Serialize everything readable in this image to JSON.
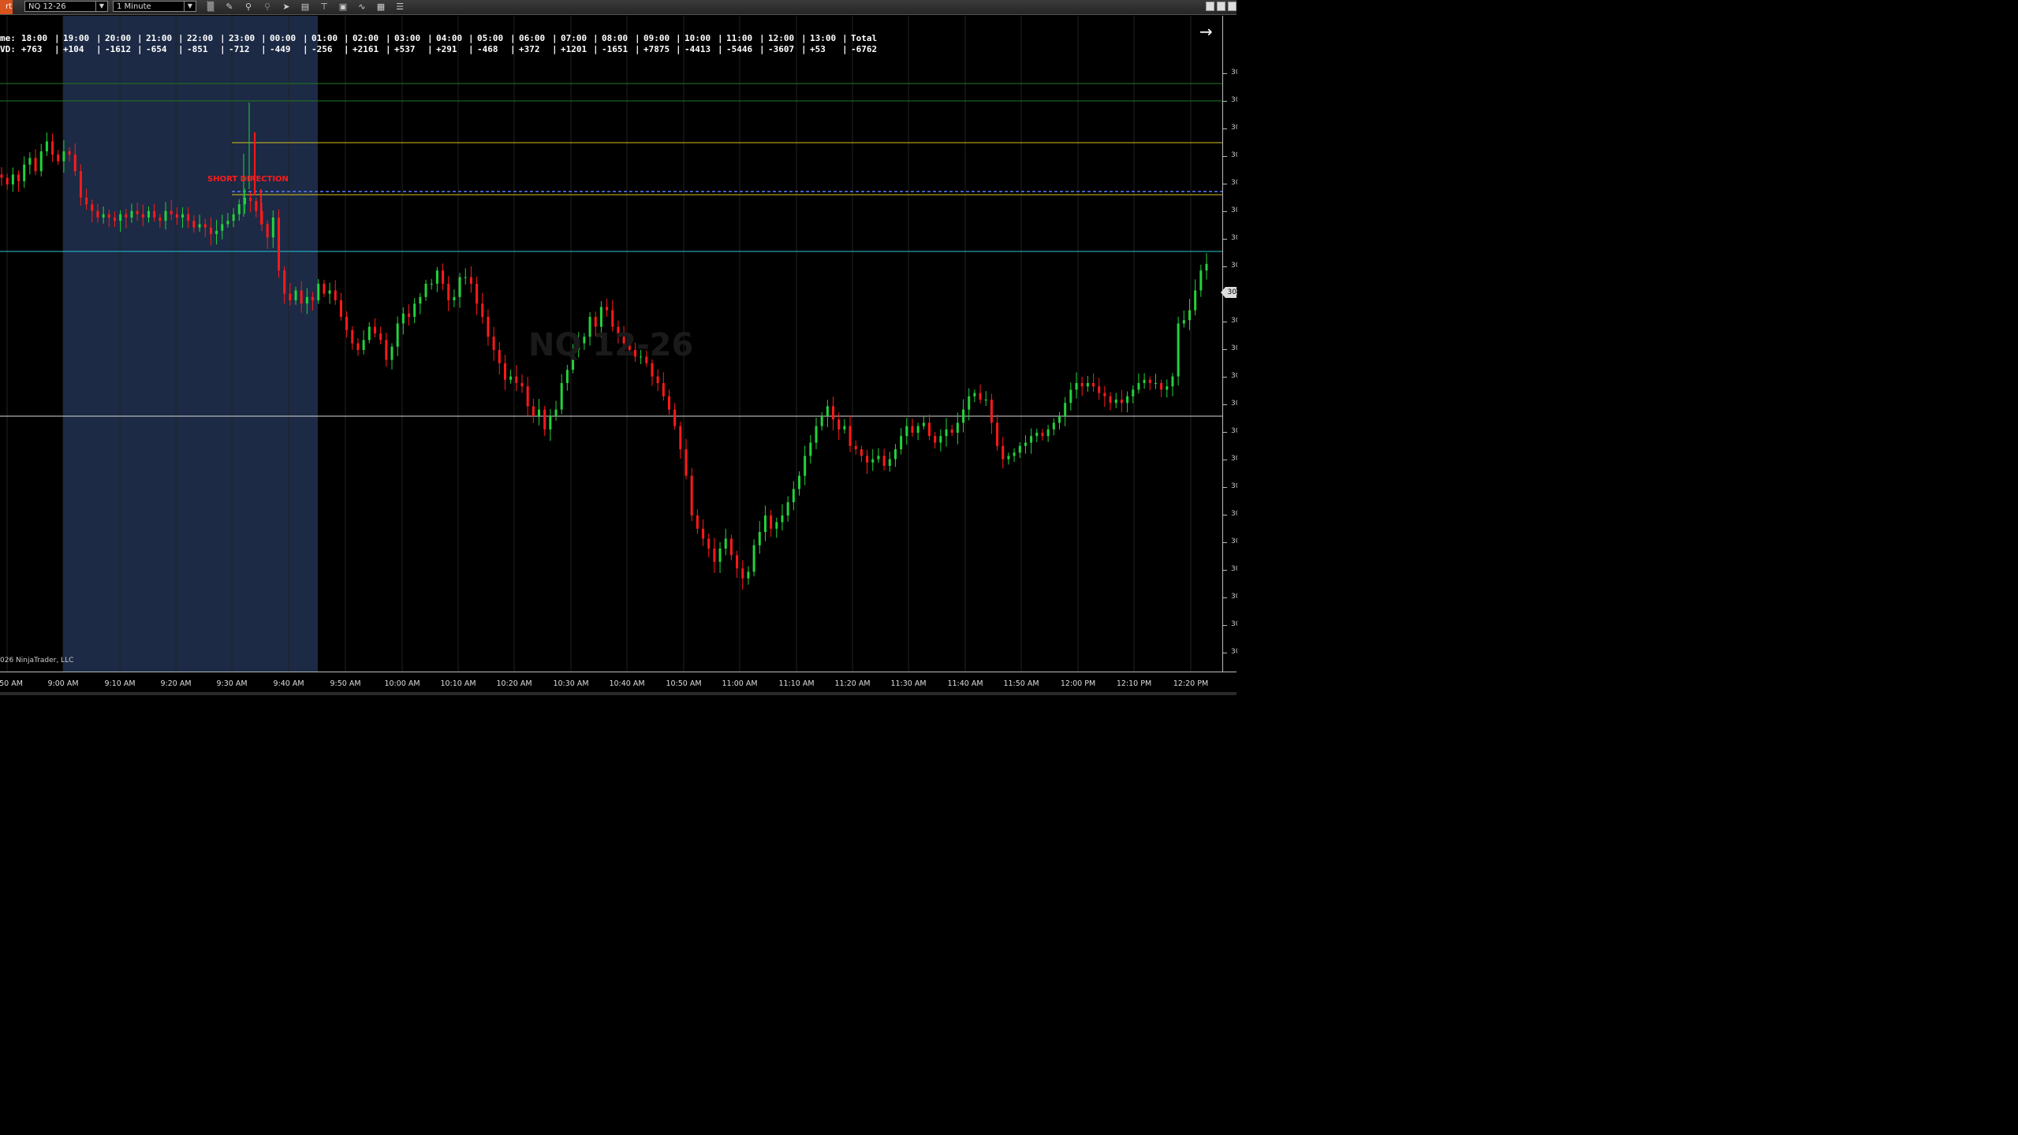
{
  "app_tab": "rt",
  "instrument": "NQ 12-26",
  "interval": "1 Minute",
  "toolbar_icons": [
    "bar-chart-icon",
    "pencil-icon",
    "zoom-in-icon",
    "zoom-out-icon",
    "pointer-icon",
    "document-icon",
    "indicators-icon",
    "strategies-icon",
    "drawing-tools-icon",
    "properties-icon",
    "list-icon"
  ],
  "colors": {
    "up": "#22d33b",
    "down": "#ff1a1a",
    "session_shade": "#1c2a45",
    "green_line": "#1f7a1f",
    "yellow_line": "#d8c21a",
    "blue_dash": "#5b7dff",
    "cyan_line": "#27c7d6",
    "white_line": "#d9d9d9"
  },
  "stats": {
    "time_label": "me:",
    "vd_label": "VD:",
    "hours": [
      "18:00",
      "19:00",
      "20:00",
      "21:00",
      "22:00",
      "23:00",
      "00:00",
      "01:00",
      "02:00",
      "03:00",
      "04:00",
      "05:00",
      "06:00",
      "07:00",
      "08:00",
      "09:00",
      "10:00",
      "11:00",
      "12:00",
      "13:00",
      "Total"
    ],
    "values": [
      "+763",
      "+104",
      "-1612",
      "-654",
      "-851",
      "-712",
      "-449",
      "-256",
      "+2161",
      "+537",
      "+291",
      "-468",
      "+372",
      "+1201",
      "-1651",
      "+7875",
      "-4413",
      "-5446",
      "-3607",
      "+53",
      "-6762"
    ]
  },
  "signal_label": "SHORT DIRECTION",
  "watermark": "NQ 12-26",
  "copyright": "026 NinjaTrader, LLC",
  "price_axis_label": "30",
  "current_price_label": "30",
  "x_axis_labels": [
    "50 AM",
    "9:00 AM",
    "9:10 AM",
    "9:20 AM",
    "9:30 AM",
    "9:40 AM",
    "9:50 AM",
    "10:00 AM",
    "10:10 AM",
    "10:20 AM",
    "10:30 AM",
    "10:40 AM",
    "10:50 AM",
    "11:00 AM",
    "11:10 AM",
    "11:20 AM",
    "11:30 AM",
    "11:40 AM",
    "11:50 AM",
    "12:00 PM",
    "12:10 PM",
    "12:20 PM"
  ],
  "chart_data": {
    "type": "candlestick",
    "interval": "1 Minute",
    "x_labels": [
      "50 AM",
      "9:00 AM",
      "9:10 AM",
      "9:20 AM",
      "9:30 AM",
      "9:40 AM",
      "9:50 AM",
      "10:00 AM",
      "10:10 AM",
      "10:20 AM",
      "10:30 AM",
      "10:40 AM",
      "10:50 AM",
      "11:00 AM",
      "11:10 AM",
      "11:20 AM",
      "11:30 AM",
      "11:40 AM",
      "11:50 AM",
      "12:00 PM",
      "12:10 PM",
      "12:20 PM"
    ],
    "closes": [
      0.72,
      0.7,
      0.73,
      0.71,
      0.76,
      0.78,
      0.74,
      0.8,
      0.83,
      0.79,
      0.77,
      0.8,
      0.79,
      0.74,
      0.66,
      0.64,
      0.62,
      0.6,
      0.61,
      0.6,
      0.59,
      0.61,
      0.6,
      0.62,
      0.61,
      0.6,
      0.62,
      0.6,
      0.59,
      0.62,
      0.61,
      0.6,
      0.61,
      0.59,
      0.57,
      0.58,
      0.57,
      0.55,
      0.56,
      0.58,
      0.59,
      0.61,
      0.64,
      0.66,
      0.65,
      0.62,
      0.58,
      0.54,
      0.6,
      0.44,
      0.37,
      0.35,
      0.38,
      0.34,
      0.36,
      0.35,
      0.4,
      0.37,
      0.38,
      0.35,
      0.3,
      0.26,
      0.22,
      0.2,
      0.23,
      0.27,
      0.25,
      0.23,
      0.17,
      0.21,
      0.28,
      0.31,
      0.3,
      0.34,
      0.36,
      0.4,
      0.4,
      0.44,
      0.4,
      0.35,
      0.36,
      0.42,
      0.42,
      0.4,
      0.34,
      0.3,
      0.24,
      0.2,
      0.16,
      0.11,
      0.12,
      0.1,
      0.09,
      0.03,
      0.0,
      0.02,
      -0.04,
      0.0,
      0.02,
      0.1,
      0.14,
      0.2,
      0.22,
      0.24,
      0.3,
      0.27,
      0.33,
      0.32,
      0.27,
      0.24,
      0.22,
      0.2,
      0.18,
      0.18,
      0.16,
      0.12,
      0.1,
      0.06,
      0.02,
      -0.03,
      -0.1,
      -0.18,
      -0.3,
      -0.34,
      -0.37,
      -0.4,
      -0.44,
      -0.4,
      -0.37,
      -0.42,
      -0.46,
      -0.49,
      -0.47,
      -0.39,
      -0.35,
      -0.3,
      -0.34,
      -0.32,
      -0.3,
      -0.26,
      -0.22,
      -0.18,
      -0.12,
      -0.08,
      -0.03,
      0.0,
      0.03,
      -0.01,
      -0.04,
      -0.03,
      -0.09,
      -0.1,
      -0.12,
      -0.14,
      -0.13,
      -0.12,
      -0.15,
      -0.13,
      -0.1,
      -0.06,
      -0.03,
      -0.05,
      -0.03,
      -0.02,
      -0.06,
      -0.08,
      -0.06,
      -0.04,
      -0.05,
      -0.02,
      0.02,
      0.06,
      0.07,
      0.05,
      0.05,
      -0.02,
      -0.09,
      -0.13,
      -0.12,
      -0.11,
      -0.09,
      -0.08,
      -0.06,
      -0.05,
      -0.06,
      -0.04,
      -0.02,
      0.0,
      0.04,
      0.08,
      0.1,
      0.09,
      0.1,
      0.09,
      0.07,
      0.06,
      0.04,
      0.05,
      0.04,
      0.06,
      0.08,
      0.1,
      0.11,
      0.1,
      0.1,
      0.08,
      0.09,
      0.12,
      0.28,
      0.29,
      0.32,
      0.38,
      0.44,
      0.46
    ]
  }
}
